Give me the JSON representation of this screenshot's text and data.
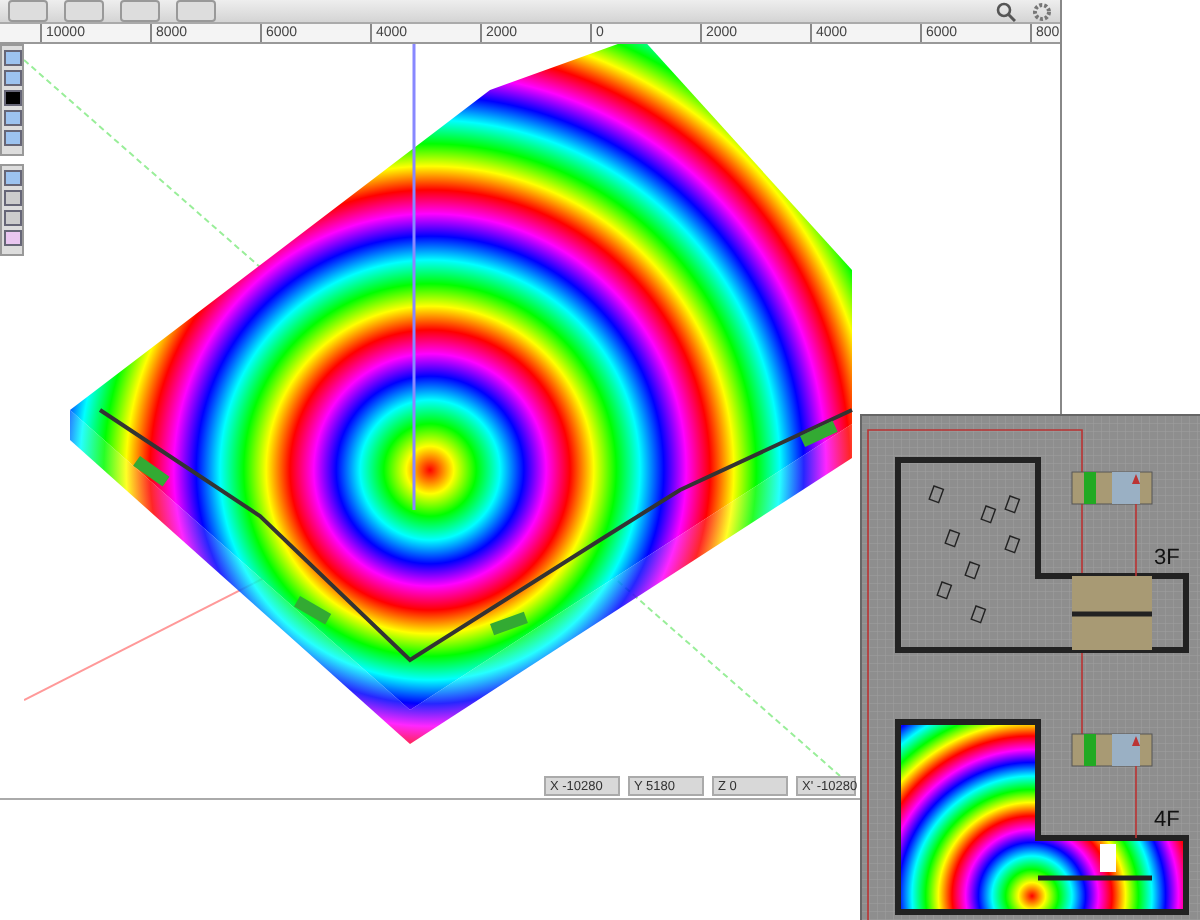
{
  "ruler": {
    "ticks": [
      "10000",
      "8000",
      "6000",
      "4000",
      "2000",
      "0",
      "2000",
      "4000",
      "6000",
      "800"
    ]
  },
  "status_bar": [
    {
      "axis": "X",
      "value": "-10280"
    },
    {
      "axis": "Y",
      "value": "5180"
    },
    {
      "axis": "Z",
      "value": "0"
    },
    {
      "axis": "X'",
      "value": "-10280"
    }
  ],
  "floor_plan": {
    "floors": [
      {
        "label": "3F",
        "kind": "furnished"
      },
      {
        "label": "4F",
        "kind": "heatmap"
      }
    ]
  }
}
